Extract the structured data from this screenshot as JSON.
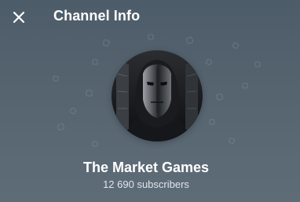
{
  "header": {
    "title": "Channel Info",
    "close_icon": "close-icon"
  },
  "channel": {
    "name": "The Market Games",
    "subscribers": "12 690 subscribers",
    "avatar_icon": "masked-figure-avatar"
  },
  "colors": {
    "background": "#55636f",
    "title_text": "#ffffff",
    "subtitle_text": "#dfe5ea"
  }
}
